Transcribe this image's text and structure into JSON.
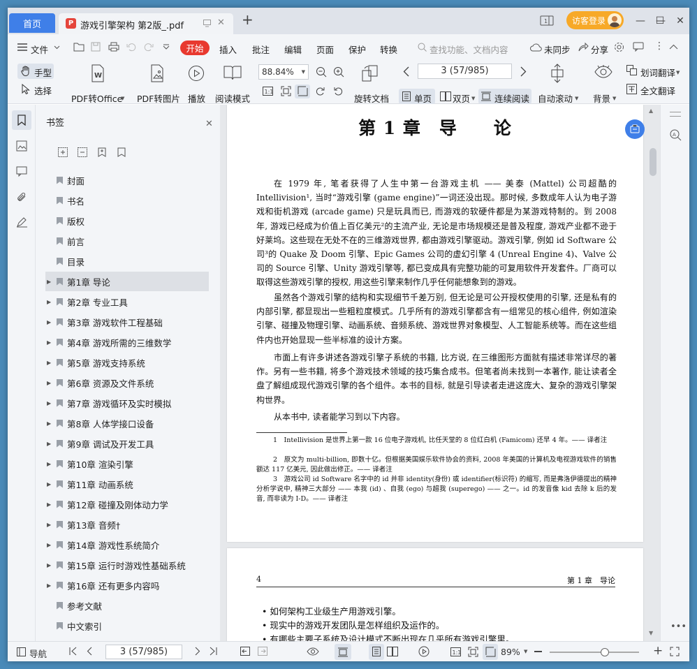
{
  "titlebar": {
    "home_tab": "首页",
    "doc_tab": "游戏引擎架构 第2版_.pdf",
    "pdf_badge": "P",
    "new_tab": "+",
    "login": "访客登录",
    "minimize": "—",
    "maximize": "☐",
    "close": "✕",
    "tab_close": "✕"
  },
  "menubar": {
    "file": "文件",
    "items": [
      "开始",
      "插入",
      "批注",
      "编辑",
      "页面",
      "保护",
      "转换"
    ],
    "search_placeholder": "查找功能、文档内容",
    "sync": "未同步",
    "share": "分享"
  },
  "toolbar": {
    "hand": "手型",
    "select": "选择",
    "pdf_to_office": "PDF转Office",
    "pdf_to_image": "PDF转图片",
    "play": "播放",
    "read_mode": "阅读模式",
    "zoom": "88.84%",
    "page_indicator": "3 (57/985)",
    "rotate": "旋转文档",
    "single": "单页",
    "double": "双页",
    "continuous": "连续阅读",
    "auto_scroll": "自动滚动",
    "background": "背景",
    "translate_words": "划词翻译",
    "full_translate": "全文翻译"
  },
  "bookmarks": {
    "title": "书签",
    "selected_index": 5,
    "items": [
      {
        "label": "封面",
        "expandable": false
      },
      {
        "label": "书名",
        "expandable": false
      },
      {
        "label": "版权",
        "expandable": false
      },
      {
        "label": "前言",
        "expandable": false
      },
      {
        "label": "目录",
        "expandable": false
      },
      {
        "label": "第1章 导论",
        "expandable": true
      },
      {
        "label": "第2章 专业工具",
        "expandable": true
      },
      {
        "label": "第3章 游戏软件工程基础",
        "expandable": true
      },
      {
        "label": "第4章 游戏所需的三维数学",
        "expandable": true
      },
      {
        "label": "第5章 游戏支持系统",
        "expandable": true
      },
      {
        "label": "第6章 资源及文件系统",
        "expandable": true
      },
      {
        "label": "第7章 游戏循环及实时模拟",
        "expandable": true
      },
      {
        "label": "第8章 人体学接口设备",
        "expandable": true
      },
      {
        "label": "第9章 调试及开发工具",
        "expandable": true
      },
      {
        "label": "第10章 渲染引擎",
        "expandable": true
      },
      {
        "label": "第11章 动画系统",
        "expandable": true
      },
      {
        "label": "第12章 碰撞及刚体动力学",
        "expandable": true
      },
      {
        "label": "第13章 音频†",
        "expandable": true
      },
      {
        "label": "第14章 游戏性系统简介",
        "expandable": true
      },
      {
        "label": "第15章 运行时游戏性基础系统",
        "expandable": true
      },
      {
        "label": "第16章 还有更多内容吗",
        "expandable": true
      },
      {
        "label": "参考文献",
        "expandable": false
      },
      {
        "label": "中文索引",
        "expandable": false
      },
      {
        "label": "英文索引",
        "expandable": false
      }
    ]
  },
  "page1": {
    "title": "第 1 章　导　　论",
    "paragraphs": [
      "在 1979 年, 笔者获得了人生中第一台游戏主机 —— 美泰 (Mattel) 公司超酷的 Intellivision¹, 当时“游戏引擎 (game engine)”一词还没出现。那时候, 多数成年人认为电子游戏和街机游戏 (arcade game) 只是玩具而已, 而游戏的软硬件都是为某游戏特制的。到 2008 年, 游戏已经成为价值上百亿美元²的主流产业, 无论是市场规模还是普及程度, 游戏产业都不逊于好莱坞。这些现在无处不在的三维游戏世界, 都由游戏引擎驱动。游戏引擎, 例如 id Software 公司³的 Quake 及 Doom 引擎、Epic Games 公司的虚幻引擎 4 (Unreal Engine 4)、Valve 公司的 Source 引擎、Unity 游戏引擎等, 都已变成具有完整功能的可复用软件开发套件。厂商可以取得这些游戏引擎的授权, 用这些引擎来制作几乎任何能想象到的游戏。",
      "虽然各个游戏引擎的结构和实现细节千差万别, 但无论是可公开授权使用的引擎, 还是私有的内部引擎, 都显现出一些粗粒度模式。几乎所有的游戏引擎都含有一组常见的核心组件, 例如渲染引擎、碰撞及物理引擎、动画系统、音频系统、游戏世界对象模型、人工智能系统等。而在这些组件内也开始显现一些半标准的设计方案。",
      "市面上有许多讲述各游戏引擎子系统的书籍, 比方说, 在三维图形方面就有描述非常详尽的著作。另有一些书籍, 将多个游戏技术领域的技巧集合成书。但笔者尚未找到一本著作, 能让读者全盘了解组成现代游戏引擎的各个组件。本书的目标, 就是引导读者走进这庞大、复杂的游戏引擎架构世界。",
      "从本书中, 读者能学习到以下内容。"
    ],
    "footnotes": [
      "1　Intellivision 是世界上第一款 16 位电子游戏机, 比任天堂的 8 位红白机 (Famicom) 还早 4 年。—— 译者注",
      "2　原文为 multi-billion, 即数十亿。但根据美国娱乐软件协会的资料, 2008 年美国的计算机及电视游戏软件的销售额达 117 亿美元, 因此做出修正。—— 译者注",
      "3　游戏公司 id Software 名字中的 id 并非 identity(身份) 或 identifier(标识符) 的缩写, 而是弗洛伊德提出的精神分析学说中, 精神三大部分 —— 本我 (id) 、自我 (ego) 与超我 (superego) —— 之一。id 的发音像 kid 去除 k 后的发音, 而非读为 I-D。—— 译者注"
    ]
  },
  "page2": {
    "page_number": "4",
    "running_head": "第 1 章　导论",
    "bullets": [
      "如何架构工业级生产用游戏引擎。",
      "现实中的游戏开发团队是怎样组织及运作的。",
      "有哪些主要子系统及设计模式不断出现在几乎所有游戏引擎里。"
    ]
  },
  "statusbar": {
    "nav": "导航",
    "page_indicator": "3 (57/985)",
    "zoom": "89%",
    "zoom_slider": 0.62
  },
  "colors": {
    "accent_blue": "#3f7fe8",
    "start_red": "#e8392f",
    "login_orange": "#f7a928",
    "pdf_red": "#e5453c"
  }
}
